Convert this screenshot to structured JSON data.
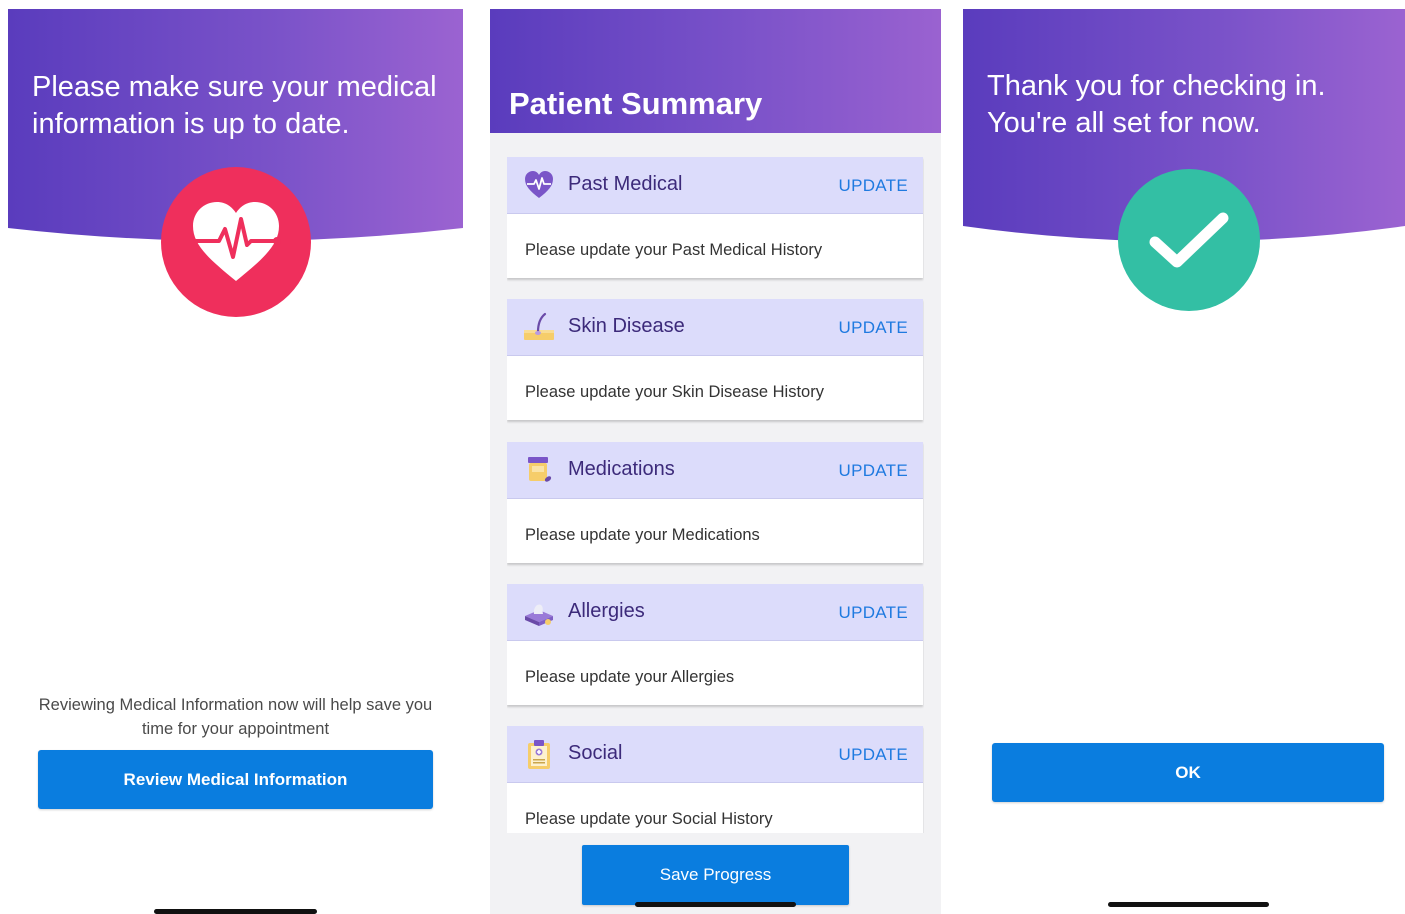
{
  "screen1": {
    "heading": "Please make sure your medical information is up to date.",
    "icon": "heart-pulse-icon",
    "note": "Reviewing Medical Information now will help save you time for your appointment",
    "button_label": "Review Medical Information"
  },
  "screen2": {
    "title": "Patient Summary",
    "update_label": "UPDATE",
    "cards": [
      {
        "title": "Past Medical",
        "description": "Please update your Past Medical History",
        "icon": "heart-pulse-icon"
      },
      {
        "title": "Skin Disease",
        "description": "Please update your Skin Disease History",
        "icon": "skin-hair-icon"
      },
      {
        "title": "Medications",
        "description": "Please update your Medications",
        "icon": "pill-bottle-icon"
      },
      {
        "title": "Allergies",
        "description": "Please update your Allergies",
        "icon": "tissue-box-icon"
      },
      {
        "title": "Social",
        "description": "Please update your Social History",
        "icon": "clipboard-icon"
      }
    ],
    "save_label": "Save Progress"
  },
  "screen3": {
    "heading": "Thank you for checking in. You're all set for now.",
    "icon": "checkmark-icon",
    "button_label": "OK"
  },
  "colors": {
    "header_start": "#5a3cbd",
    "header_end": "#9a62d0",
    "heart_red": "#ef2f5c",
    "success_green": "#33bfa4",
    "button_blue": "#0a7ddf",
    "card_header": "#dcdcfb",
    "link_blue": "#1f7ae0"
  }
}
